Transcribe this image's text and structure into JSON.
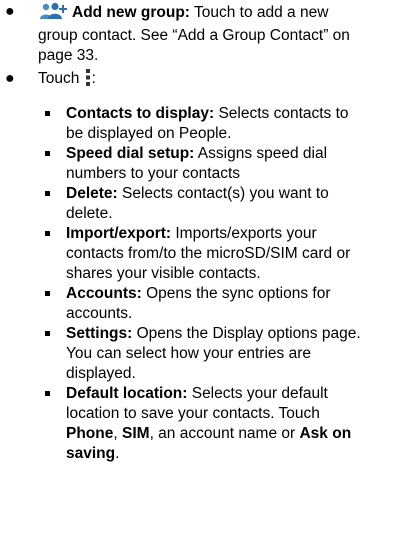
{
  "item_add_group": {
    "icon": "group-add-icon",
    "term": "Add new group:",
    "text": " Touch to add a new group contact. See “Add a Group Contact” on page 33."
  },
  "item_touch": {
    "text_before": "Touch ",
    "icon": "menu-icon",
    "text_after": ":"
  },
  "sub_items": [
    {
      "term": "Contacts to display:",
      "text": " Selects contacts to be displayed on People."
    },
    {
      "term": "Speed dial setup:",
      "text": " Assigns speed dial numbers to your contacts"
    },
    {
      "term": "Delete:",
      "text": " Selects contact(s) you want to delete."
    },
    {
      "term": "Import/export:",
      "text": " Imports/exports your contacts from/to the microSD/SIM card or shares your visible contacts."
    },
    {
      "term": "Accounts:",
      "text": " Opens the sync options for accounts."
    },
    {
      "term": "Settings:",
      "text": " Opens the Display options page. You can select how your entries are displayed."
    },
    {
      "term": "Default location:",
      "text": " Selects your default location to save your contacts. Touch ",
      "opt1": "Phone",
      "sep1": ", ",
      "opt2": "SIM",
      "sep2": ", an account name or ",
      "opt3": "Ask on saving",
      "end": "."
    }
  ],
  "colors": {
    "group_icon": "#4a8bc9"
  }
}
